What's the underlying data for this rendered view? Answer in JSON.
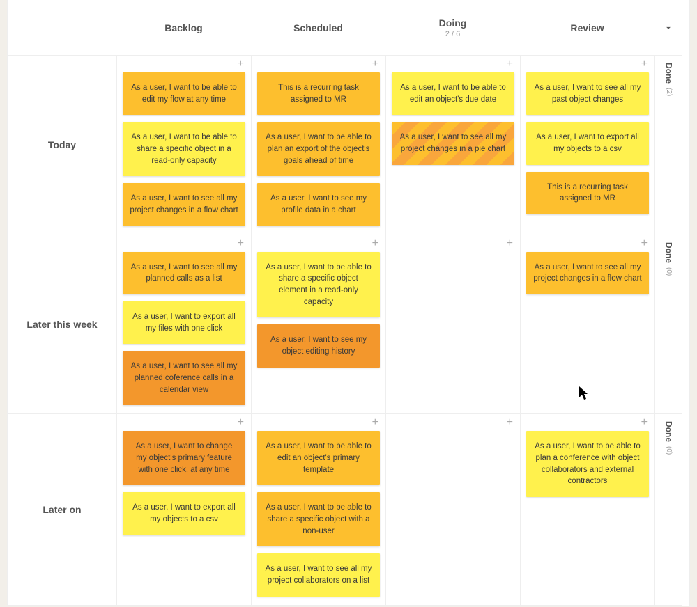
{
  "columns": [
    {
      "label": "Backlog",
      "sub": ""
    },
    {
      "label": "Scheduled",
      "sub": ""
    },
    {
      "label": "Doing",
      "sub": "2 / 6"
    },
    {
      "label": "Review",
      "sub": ""
    }
  ],
  "swimlanes": [
    {
      "label": "Today",
      "done": {
        "label": "Done",
        "count": "(2)"
      },
      "cells": [
        [
          {
            "text": "As a user, I want to be able to edit my flow at any time",
            "color": "gold"
          },
          {
            "text": "As a user, I want to be able to share a specific object in a read-only capacity",
            "color": "yellow"
          },
          {
            "text": "As a user, I want to see all my project changes in a flow chart",
            "color": "gold"
          }
        ],
        [
          {
            "text": "This is a recurring task assigned to MR",
            "color": "gold"
          },
          {
            "text": "As a user, I want to be able to plan an export of the object's goals ahead of time",
            "color": "gold"
          },
          {
            "text": "As a user, I want to see my profile data in a chart",
            "color": "gold"
          }
        ],
        [
          {
            "text": "As a user, I want to be able to edit an object's due date",
            "color": "yellow"
          },
          {
            "text": "As a user, I want to see all my project changes in a pie chart",
            "color": "striped"
          }
        ],
        [
          {
            "text": "As a user, I want to see all my past object changes",
            "color": "yellow"
          },
          {
            "text": "As a user, I want to export all my objects to a csv",
            "color": "yellow"
          },
          {
            "text": "This is a recurring task assigned to MR",
            "color": "gold"
          }
        ]
      ]
    },
    {
      "label": "Later this week",
      "done": {
        "label": "Done",
        "count": "(0)"
      },
      "cells": [
        [
          {
            "text": "As a user, I want to see all my planned calls as a list",
            "color": "gold"
          },
          {
            "text": "As a user, I want to export all my files with one click",
            "color": "yellow"
          },
          {
            "text": "As a user, I want to see all my planned coference calls in a calendar view",
            "color": "orange"
          }
        ],
        [
          {
            "text": "As a user, I want to be able to share a specific object element in a read-only capacity",
            "color": "yellow"
          },
          {
            "text": "As a user, I want to see my object editing history",
            "color": "orange"
          }
        ],
        [],
        [
          {
            "text": "As a user, I want to see all my project changes in a flow chart",
            "color": "gold"
          }
        ]
      ]
    },
    {
      "label": "Later on",
      "done": {
        "label": "Done",
        "count": "(0)"
      },
      "cells": [
        [
          {
            "text": "As a user, I want to change my object's primary feature with one click, at any time",
            "color": "orange"
          },
          {
            "text": "As a user, I want to export all my objects to a csv",
            "color": "yellow"
          }
        ],
        [
          {
            "text": "As a user, I want to be able to edit an object's primary template",
            "color": "gold"
          },
          {
            "text": "As a user, I want to be able to share a specific object with a non-user",
            "color": "gold"
          },
          {
            "text": "As a user, I want to see all my project collaborators on a list",
            "color": "yellow"
          }
        ],
        [],
        [
          {
            "text": "As a user, I want to be able to plan a conference with object collaborators and external contractors",
            "color": "yellow"
          }
        ]
      ]
    }
  ],
  "add_glyph": "+"
}
